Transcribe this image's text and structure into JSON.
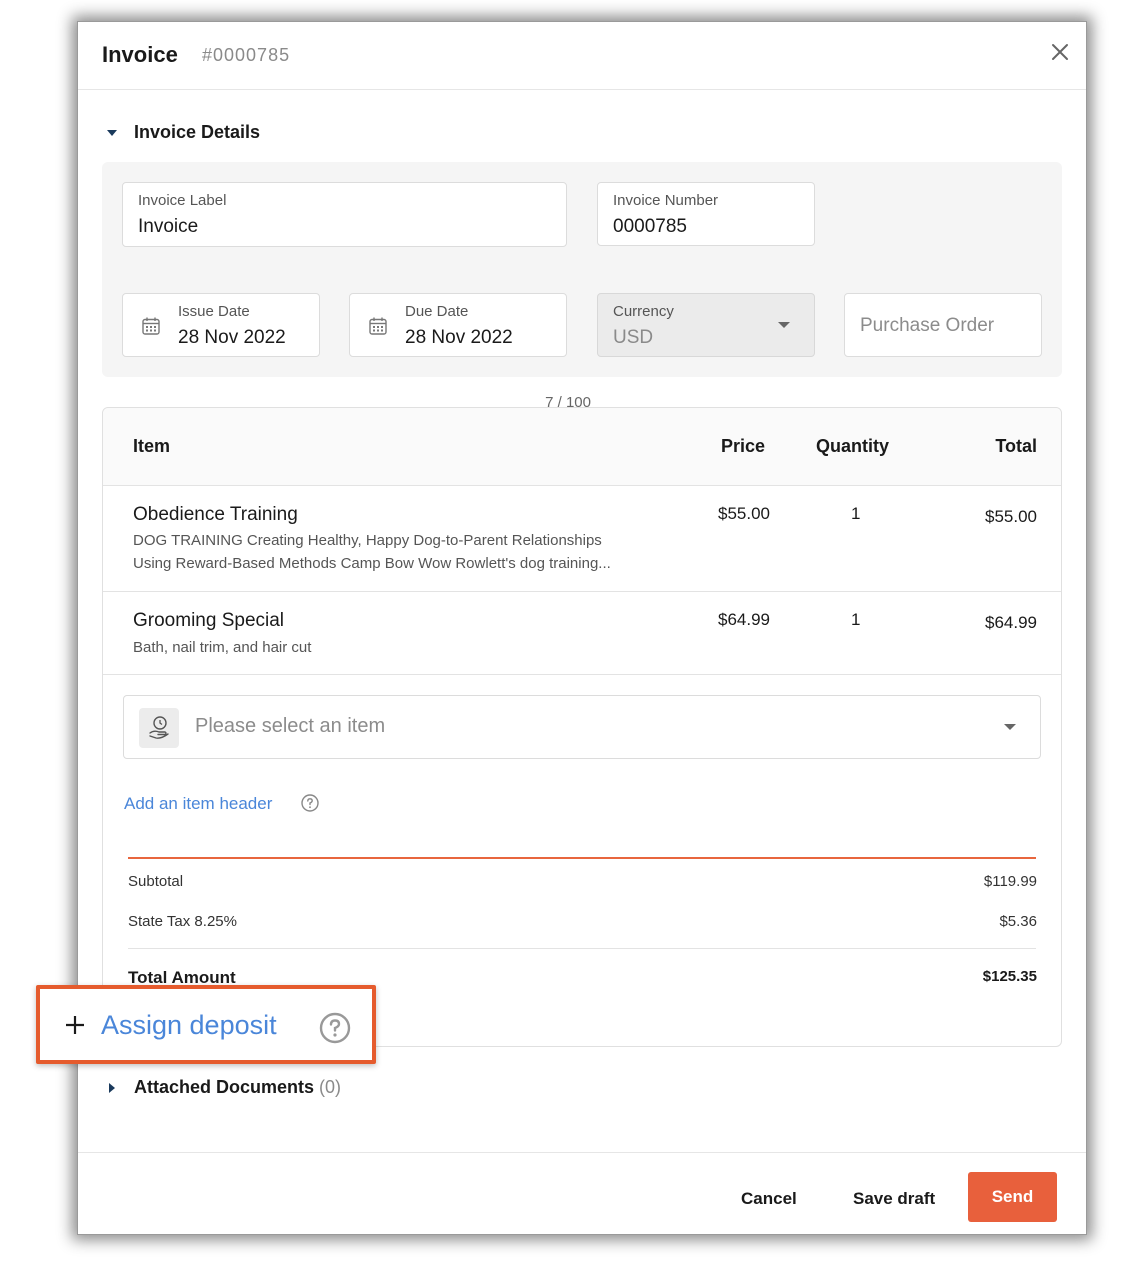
{
  "header": {
    "title": "Invoice",
    "number": "#0000785"
  },
  "details": {
    "section_title": "Invoice Details",
    "invoice_label": {
      "label": "Invoice Label",
      "value": "Invoice",
      "counter": "7 / 100"
    },
    "invoice_number": {
      "label": "Invoice Number",
      "value": "0000785"
    },
    "issue_date": {
      "label": "Issue Date",
      "value": "28 Nov 2022"
    },
    "due_date": {
      "label": "Due Date",
      "value": "28 Nov 2022"
    },
    "currency": {
      "label": "Currency",
      "value": "USD"
    },
    "purchase_order": {
      "placeholder": "Purchase Order"
    }
  },
  "items": {
    "columns": {
      "item": "Item",
      "price": "Price",
      "quantity": "Quantity",
      "total": "Total"
    },
    "rows": [
      {
        "name": "Obedience Training",
        "desc1": "DOG TRAINING Creating Healthy, Happy Dog-to-Parent Relationships",
        "desc2": "Using Reward-Based Methods Camp Bow Wow Rowlett's dog training...",
        "price": "$55.00",
        "quantity": "1",
        "total": "$55.00"
      },
      {
        "name": "Grooming Special",
        "desc1": "Bath, nail trim, and hair cut",
        "price": "$64.99",
        "quantity": "1",
        "total": "$64.99"
      }
    ],
    "select_placeholder": "Please select an item",
    "add_header_link": "Add an item header"
  },
  "summary": {
    "subtotal_label": "Subtotal",
    "subtotal_value": "$119.99",
    "tax_label": "State Tax 8.25%",
    "tax_value": "$5.36",
    "total_label": "Total Amount",
    "total_value": "$125.35"
  },
  "deposit": {
    "label": "Assign deposit"
  },
  "attachments": {
    "label": "Attached Documents",
    "count": "(0)"
  },
  "footer": {
    "cancel": "Cancel",
    "save_draft": "Save draft",
    "send": "Send"
  },
  "colors": {
    "accent": "#e8603c",
    "link": "#4a86d9"
  }
}
